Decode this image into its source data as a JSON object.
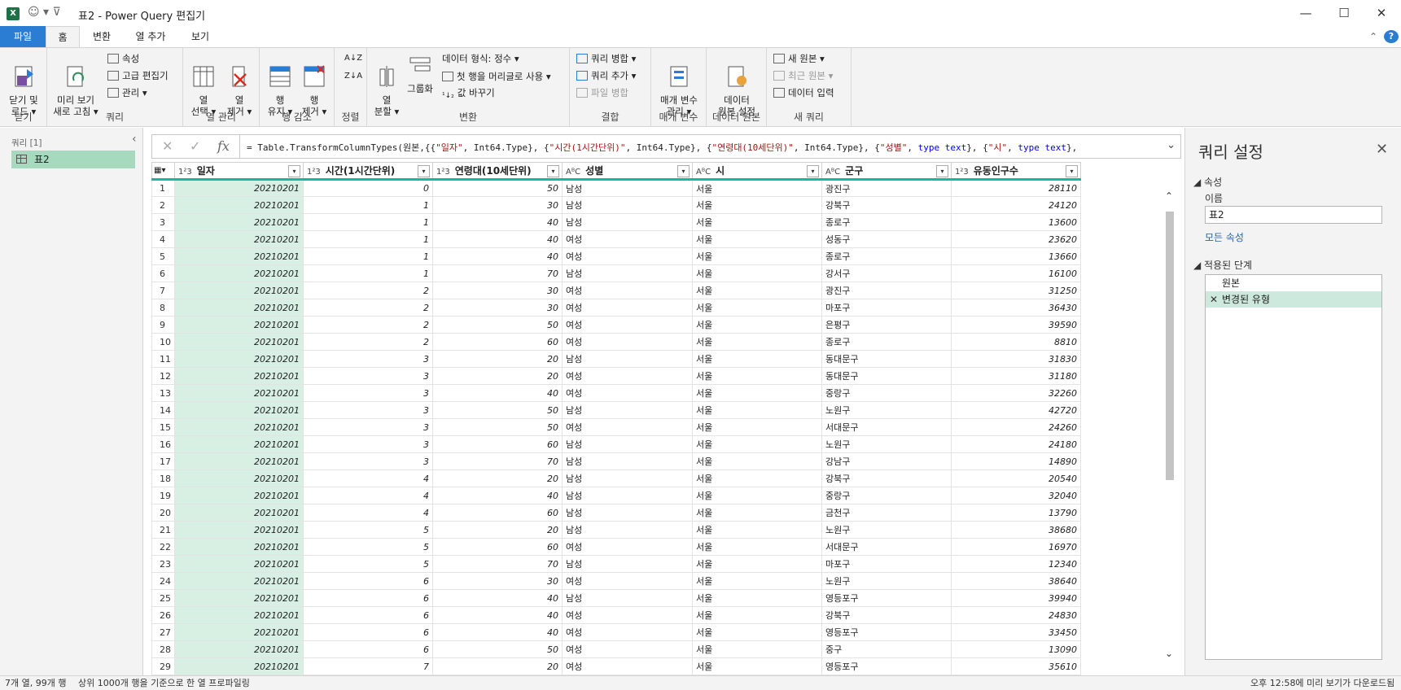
{
  "window": {
    "title": "표2 - Power Query 편집기",
    "app_icon": "excel-icon",
    "minimize": "—",
    "maximize": "☐",
    "close": "✕"
  },
  "tabs": [
    "파일",
    "홈",
    "변환",
    "열 추가",
    "보기"
  ],
  "ribbon": {
    "close_group": {
      "label": "닫기",
      "close_load": "닫기 및\n로드 ▾"
    },
    "query_group": {
      "label": "쿼리",
      "refresh_preview": "미리 보기\n새로 고침 ▾",
      "properties": "속성",
      "advanced_editor": "고급 편집기",
      "manage": "관리 ▾"
    },
    "manage_columns": {
      "label": "열 관리",
      "choose_columns": "열\n선택 ▾",
      "remove_columns": "열\n제거 ▾"
    },
    "reduce_rows": {
      "label": "행 감소",
      "keep_rows": "행\n유지 ▾",
      "remove_rows": "행\n제거 ▾"
    },
    "sort": {
      "label": "정렬"
    },
    "transform": {
      "label": "변환",
      "split_column": "열\n분할 ▾",
      "group_by": "그룹화",
      "data_type": "데이터 형식: 정수 ▾",
      "use_first_row": "첫 행을 머리글로 사용 ▾",
      "replace_values": "값 바꾸기"
    },
    "combine": {
      "label": "결합",
      "merge_queries": "쿼리 병합 ▾",
      "append_queries": "쿼리 추가 ▾",
      "combine_files": "파일 병합"
    },
    "parameters": {
      "label": "매개 변수",
      "manage_params": "매개 변수\n관리 ▾"
    },
    "data_sources": {
      "label": "데이터 원본",
      "source_settings": "데이터\n원본 설정"
    },
    "new_query": {
      "label": "새 쿼리",
      "new_source": "새 원본 ▾",
      "recent_sources": "최근 원본 ▾",
      "enter_data": "데이터 입력"
    }
  },
  "left_pane": {
    "header": "쿼리 [1]",
    "query_name": "표2"
  },
  "formula_bar": {
    "fx": "fx",
    "p1": "= Table.TransformColumnTypes(원본,{{",
    "s1": "\"일자\"",
    "p2": ", Int64.Type}, {",
    "s2": "\"시간(1시간단위)\"",
    "p3": ", Int64.Type}, {",
    "s3": "\"연령대(10세단위)\"",
    "p4": ", Int64.Type}, {",
    "s4": "\"성별\"",
    "p5": ", ",
    "k1": "type text",
    "p6": "}, {",
    "s5": "\"시\"",
    "p7": ", ",
    "k2": "type text",
    "p8": "},"
  },
  "columns": [
    {
      "type": "1²3",
      "name": "일자"
    },
    {
      "type": "1²3",
      "name": "시간(1시간단위)"
    },
    {
      "type": "1²3",
      "name": "연령대(10세단위)"
    },
    {
      "type": "AᴮC",
      "name": "성별"
    },
    {
      "type": "AᴮC",
      "name": "시"
    },
    {
      "type": "AᴮC",
      "name": "군구"
    },
    {
      "type": "1²3",
      "name": "유동인구수"
    }
  ],
  "rows": [
    [
      "20210201",
      "0",
      "50",
      "남성",
      "서울",
      "광진구",
      "28110"
    ],
    [
      "20210201",
      "1",
      "30",
      "남성",
      "서울",
      "강북구",
      "24120"
    ],
    [
      "20210201",
      "1",
      "40",
      "남성",
      "서울",
      "종로구",
      "13600"
    ],
    [
      "20210201",
      "1",
      "40",
      "여성",
      "서울",
      "성동구",
      "23620"
    ],
    [
      "20210201",
      "1",
      "40",
      "여성",
      "서울",
      "종로구",
      "13660"
    ],
    [
      "20210201",
      "1",
      "70",
      "남성",
      "서울",
      "강서구",
      "16100"
    ],
    [
      "20210201",
      "2",
      "30",
      "여성",
      "서울",
      "광진구",
      "31250"
    ],
    [
      "20210201",
      "2",
      "30",
      "여성",
      "서울",
      "마포구",
      "36430"
    ],
    [
      "20210201",
      "2",
      "50",
      "여성",
      "서울",
      "은평구",
      "39590"
    ],
    [
      "20210201",
      "2",
      "60",
      "여성",
      "서울",
      "종로구",
      "8810"
    ],
    [
      "20210201",
      "3",
      "20",
      "남성",
      "서울",
      "동대문구",
      "31830"
    ],
    [
      "20210201",
      "3",
      "20",
      "여성",
      "서울",
      "동대문구",
      "31180"
    ],
    [
      "20210201",
      "3",
      "40",
      "여성",
      "서울",
      "중랑구",
      "32260"
    ],
    [
      "20210201",
      "3",
      "50",
      "남성",
      "서울",
      "노원구",
      "42720"
    ],
    [
      "20210201",
      "3",
      "50",
      "여성",
      "서울",
      "서대문구",
      "24260"
    ],
    [
      "20210201",
      "3",
      "60",
      "남성",
      "서울",
      "노원구",
      "24180"
    ],
    [
      "20210201",
      "3",
      "70",
      "남성",
      "서울",
      "강남구",
      "14890"
    ],
    [
      "20210201",
      "4",
      "20",
      "남성",
      "서울",
      "강북구",
      "20540"
    ],
    [
      "20210201",
      "4",
      "40",
      "남성",
      "서울",
      "중랑구",
      "32040"
    ],
    [
      "20210201",
      "4",
      "60",
      "남성",
      "서울",
      "금천구",
      "13790"
    ],
    [
      "20210201",
      "5",
      "20",
      "남성",
      "서울",
      "노원구",
      "38680"
    ],
    [
      "20210201",
      "5",
      "60",
      "여성",
      "서울",
      "서대문구",
      "16970"
    ],
    [
      "20210201",
      "5",
      "70",
      "남성",
      "서울",
      "마포구",
      "12340"
    ],
    [
      "20210201",
      "6",
      "30",
      "여성",
      "서울",
      "노원구",
      "38640"
    ],
    [
      "20210201",
      "6",
      "40",
      "남성",
      "서울",
      "영등포구",
      "39940"
    ],
    [
      "20210201",
      "6",
      "40",
      "여성",
      "서울",
      "강북구",
      "24830"
    ],
    [
      "20210201",
      "6",
      "40",
      "여성",
      "서울",
      "영등포구",
      "33450"
    ],
    [
      "20210201",
      "6",
      "50",
      "여성",
      "서울",
      "중구",
      "13090"
    ],
    [
      "20210201",
      "7",
      "20",
      "여성",
      "서울",
      "영등포구",
      "35610"
    ]
  ],
  "right_pane": {
    "title": "쿼리 설정",
    "properties_label": "◢ 속성",
    "name_label": "이름",
    "name_value": "표2",
    "all_properties": "모든 속성",
    "applied_steps_label": "◢ 적용된 단계",
    "steps": [
      "원본",
      "변경된 유형"
    ]
  },
  "status": {
    "left": "7개 열, 99개 행",
    "middle": "상위 1000개 행을 기준으로 한 열 프로파일링",
    "right": "오후 12:58에 미리 보기가 다운로드됨"
  },
  "colors": {
    "accent": "#2b7cd3",
    "selected_column": "#d7f0e3",
    "header_underline": "#1eb3a6"
  }
}
